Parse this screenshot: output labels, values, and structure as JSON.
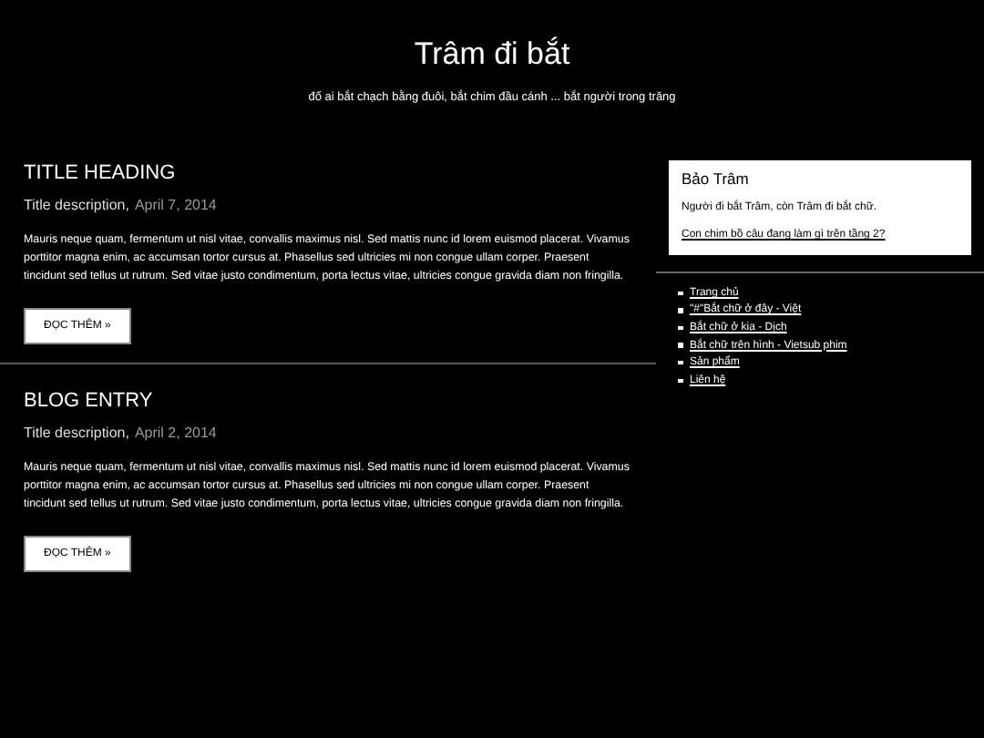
{
  "header": {
    "title": "Trâm đi bắt",
    "tagline": "đố ai bắt chạch bằng đuôi, bắt chim đầu cánh ...  bắt người trong trăng"
  },
  "posts": [
    {
      "title": "TITLE HEADING",
      "description": "Title description,",
      "date": "April 7, 2014",
      "body": "Mauris neque quam, fermentum ut nisl vitae, convallis maximus nisl. Sed mattis nunc id lorem euismod placerat. Vivamus porttitor magna enim, ac accumsan tortor cursus at. Phasellus sed ultricies mi non congue ullam corper. Praesent tincidunt sed tellus ut rutrum. Sed vitae justo condimentum, porta lectus vitae, ultricies congue gravida diam non fringilla.",
      "button": "ĐỌC THÊM »"
    },
    {
      "title": "BLOG ENTRY",
      "description": "Title description,",
      "date": "April 2, 2014",
      "body": "Mauris neque quam, fermentum ut nisl vitae, convallis maximus nisl. Sed mattis nunc id lorem euismod placerat. Vivamus porttitor magna enim, ac accumsan tortor cursus at. Phasellus sed ultricies mi non congue ullam corper. Praesent tincidunt sed tellus ut rutrum. Sed vitae justo condimentum, porta lectus vitae, ultricies congue gravida diam non fringilla.",
      "button": "ĐỌC THÊM »"
    }
  ],
  "sidebar": {
    "card": {
      "title": "Bảo Trâm",
      "text": "Người đi bắt Trâm, còn Trâm đi bắt chữ.",
      "link": "Con chim bồ câu đang làm gì trên tầng 2?"
    },
    "links": [
      "Trang chủ",
      "\"#\"Bắt chữ ở đây - Việt",
      "Bắt chữ ở kia - Dịch",
      "Bắt chữ trên hình - Vietsub phim",
      "Sản phẩm",
      "Liên hệ"
    ]
  }
}
